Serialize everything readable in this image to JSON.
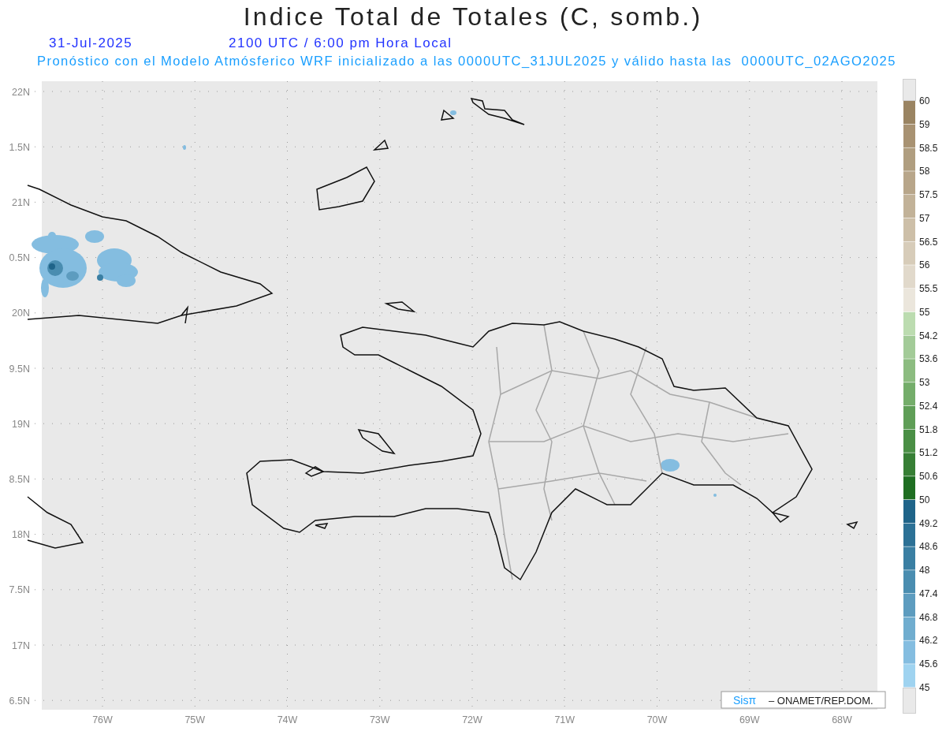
{
  "title": "Indice Total de Totales (C, somb.)",
  "date": "31-Jul-2025",
  "time": "2100 UTC / 6:00 pm Hora Local",
  "subtitle": "Pronóstico con el Modelo Atmósferico WRF inicializado a las 0000UTC_31JUL2025 y válido hasta las  0000UTC_02AGO2025",
  "map": {
    "lat_labels": [
      "22N",
      "1.5N",
      "21N",
      "0.5N",
      "20N",
      "9.5N",
      "19N",
      "8.5N",
      "18N",
      "7.5N",
      "17N",
      "6.5N"
    ],
    "lon_labels": [
      "76W",
      "75W",
      "74W",
      "73W",
      "72W",
      "71W",
      "70W",
      "69W",
      "68W"
    ]
  },
  "legend": {
    "levels": [
      "60",
      "59",
      "58.5",
      "58",
      "57.5",
      "57",
      "56.5",
      "56",
      "55.5",
      "55",
      "54.2",
      "53.6",
      "53",
      "52.4",
      "51.8",
      "51.2",
      "50.6",
      "50",
      "49.2",
      "48.6",
      "48",
      "47.4",
      "46.8",
      "46.2",
      "45.6",
      "45"
    ],
    "bins": [
      {
        "color": "#9a8462"
      },
      {
        "color": "#a89272"
      },
      {
        "color": "#b09e80"
      },
      {
        "color": "#b8a68a"
      },
      {
        "color": "#c2b298"
      },
      {
        "color": "#cdbfa8"
      },
      {
        "color": "#d7ccb9"
      },
      {
        "color": "#e1d9cb"
      },
      {
        "color": "#ebe6dc"
      },
      {
        "color": "#bcdcb0"
      },
      {
        "color": "#a3cb98"
      },
      {
        "color": "#8cbc80"
      },
      {
        "color": "#74ad6a"
      },
      {
        "color": "#5f9e57"
      },
      {
        "color": "#4a8f45"
      },
      {
        "color": "#377f35"
      },
      {
        "color": "#1f6e22"
      },
      {
        "color": "#1f6489"
      },
      {
        "color": "#2c7196"
      },
      {
        "color": "#3a7fa3"
      },
      {
        "color": "#4a8db0"
      },
      {
        "color": "#5d9cbf"
      },
      {
        "color": "#70adcf"
      },
      {
        "color": "#84bde0"
      },
      {
        "color": "#9fd3f0"
      }
    ]
  },
  "credit": {
    "brand": "Sisπ",
    "text": "– ONAMET/REP.DOM."
  }
}
